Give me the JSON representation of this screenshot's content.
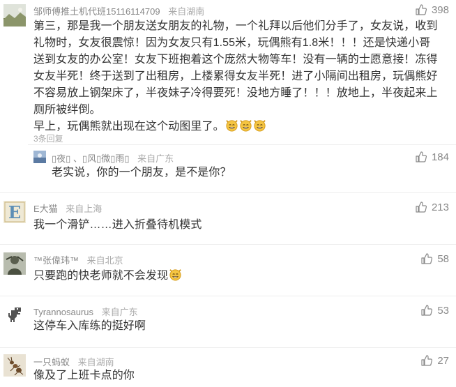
{
  "comments": [
    {
      "user": "邹师傅推土机代班15116114709",
      "location": "来自湖南",
      "likes": "398",
      "lines": [
        "第三，那是我一个朋友送女朋友的礼物，一个礼拜以后他们分手了，女友说，收到",
        "礼物时，女友很震惊！因为女友只有1.55米，玩偶熊有1.8米！！！还是快递小哥",
        "送到女友的办公室！女友下班抱着这个庞然大物等车！没有一辆的士愿意接！冻得",
        "女友半死！终于送到了出租房，上楼累得女友半死！进了小隔间出租房，玩偶熊好",
        "不容易放上钢架床了，半夜妹子冷得要死！没地方睡了！！！放地上，半夜起来上",
        "厕所被绊倒。",
        "早上，玩偶熊就出现在这个动图里了。"
      ],
      "replies_label": "3条回复"
    },
    {
      "user": "▯夜▯ 、▯风▯微▯雨▯",
      "location": "来自广东",
      "likes": "184",
      "text": "老实说，你的一个朋友，是不是你？"
    },
    {
      "user": "E大猫",
      "location": "来自上海",
      "likes": "213",
      "text": "我一个滑铲……进入折叠待机模式"
    },
    {
      "user": "™张偉玮™",
      "location": "来自北京",
      "likes": "58",
      "text": "只要跑的快老师就不会发现"
    },
    {
      "user": "Tyrannosaurus",
      "location": "来自广东",
      "likes": "53",
      "text": "这停车入库练的挺好啊"
    },
    {
      "user": "一只蚂蚁",
      "location": "来自湖南",
      "likes": "27",
      "text": "像及了上班卡点的你"
    }
  ],
  "icons": {
    "like": "thumbs-up-icon",
    "emoji": "grinning-cat-emoji-icon"
  },
  "colors": {
    "emoji": "#f5c542"
  }
}
